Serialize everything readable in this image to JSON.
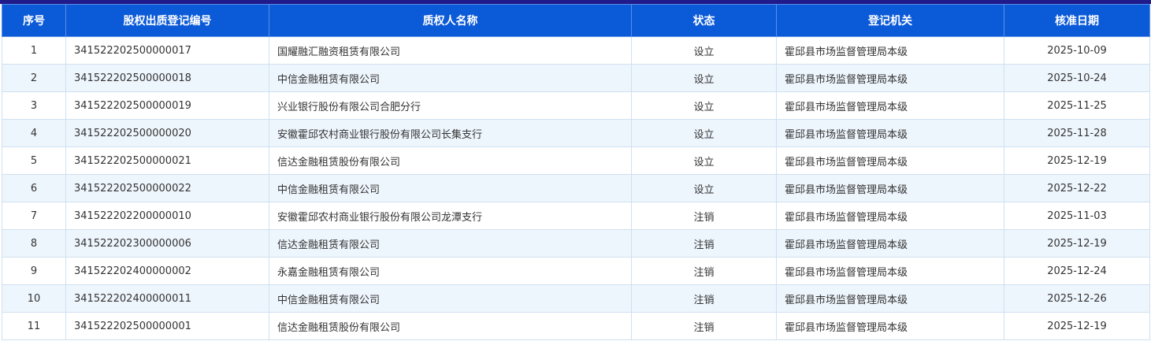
{
  "table": {
    "headers": [
      "序号",
      "股权出质登记编号",
      "质权人名称",
      "状态",
      "登记机关",
      "核准日期"
    ],
    "rows": [
      [
        "1",
        "341522202500000017",
        "国耀融汇融资租赁有限公司",
        "设立",
        "霍邱县市场监督管理局本级",
        "2025-10-09"
      ],
      [
        "2",
        "341522202500000018",
        "中信金融租赁有限公司",
        "设立",
        "霍邱县市场监督管理局本级",
        "2025-10-24"
      ],
      [
        "3",
        "341522202500000019",
        "兴业银行股份有限公司合肥分行",
        "设立",
        "霍邱县市场监督管理局本级",
        "2025-11-25"
      ],
      [
        "4",
        "341522202500000020",
        "安徽霍邱农村商业银行股份有限公司长集支行",
        "设立",
        "霍邱县市场监督管理局本级",
        "2025-11-28"
      ],
      [
        "5",
        "341522202500000021",
        "信达金融租赁股份有限公司",
        "设立",
        "霍邱县市场监督管理局本级",
        "2025-12-19"
      ],
      [
        "6",
        "341522202500000022",
        "中信金融租赁有限公司",
        "设立",
        "霍邱县市场监督管理局本级",
        "2025-12-22"
      ],
      [
        "7",
        "341522202200000010",
        "安徽霍邱农村商业银行股份有限公司龙潭支行",
        "注销",
        "霍邱县市场监督管理局本级",
        "2025-11-03"
      ],
      [
        "8",
        "341522202300000006",
        "信达金融租赁有限公司",
        "注销",
        "霍邱县市场监督管理局本级",
        "2025-12-19"
      ],
      [
        "9",
        "341522202400000002",
        "永嘉金融租赁有限公司",
        "注销",
        "霍邱县市场监督管理局本级",
        "2025-12-24"
      ],
      [
        "10",
        "341522202400000011",
        "中信金融租赁有限公司",
        "注销",
        "霍邱县市场监督管理局本级",
        "2025-12-26"
      ],
      [
        "11",
        "341522202500000001",
        "信达金融租赁股份有限公司",
        "注销",
        "霍邱县市场监督管理局本级",
        "2025-12-19"
      ]
    ]
  },
  "colors": {
    "header_bg": "#0b5ad8",
    "top_border": "#201a8a",
    "stripe": "#eef6fd"
  }
}
